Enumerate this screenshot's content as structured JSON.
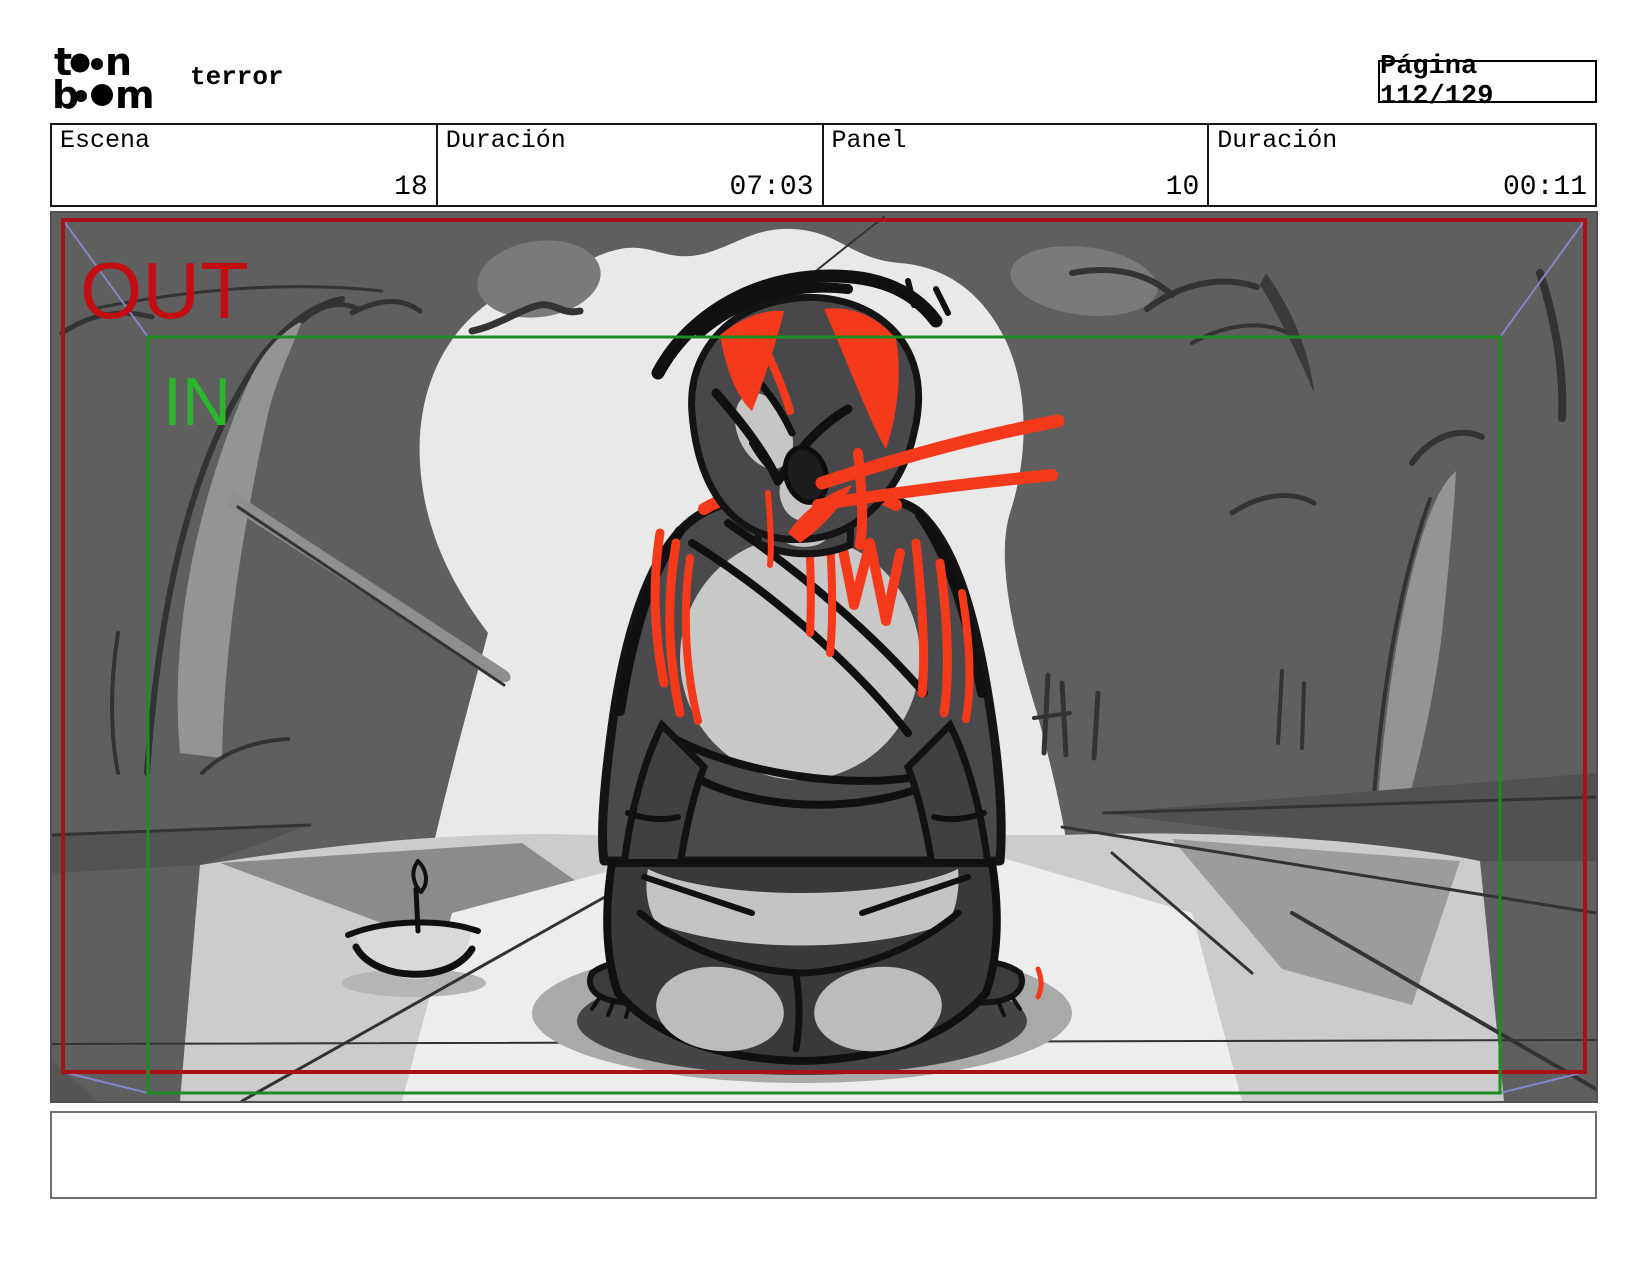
{
  "header": {
    "logo_alt": "toon boom",
    "logo_row1_left": "t",
    "logo_row1_right": "n",
    "logo_row2_left": "b",
    "logo_row2_right": "m",
    "project_title": "terror",
    "page_label": "Página 112/129"
  },
  "info_table": {
    "cells": [
      {
        "label": "Escena",
        "value": "18"
      },
      {
        "label": "Duración",
        "value": "07:03"
      },
      {
        "label": "Panel",
        "value": "10"
      },
      {
        "label": "Duración",
        "value": "00:11"
      }
    ]
  },
  "panel": {
    "camera": {
      "out_label": "OUT",
      "in_label": "IN",
      "out_frame_color": "#a81116",
      "in_frame_color": "#1e8c1e",
      "out_text_color": "#c20d12",
      "in_text_color": "#27b927",
      "path_color": "#8585c8"
    },
    "art": {
      "accent_red": "#f5391b",
      "wall_gray": "#5f5f5f",
      "moon_light": "#e9e9e9"
    },
    "caption_text": ""
  }
}
